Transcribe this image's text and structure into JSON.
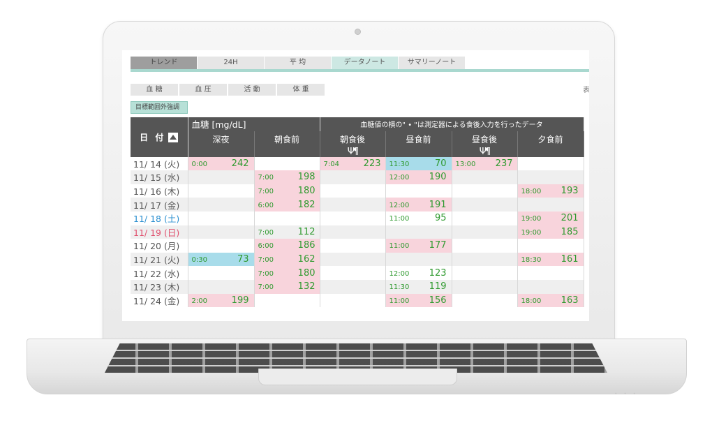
{
  "tabs": [
    "トレンド",
    "24H",
    "平 均",
    "データノート",
    "サマリーノート"
  ],
  "subtabs": [
    "血 糖",
    "血 圧",
    "活 動",
    "体 重"
  ],
  "edge_char": "表",
  "emphasis_button": "目標範囲外強調",
  "table": {
    "date_header": "日 付",
    "unit_title": "血糖 [mg/dL]",
    "note": "血糖値の横の\" • \"は測定器による食後入力を行ったデータ",
    "columns": [
      {
        "label": "深夜",
        "meal_icon": false
      },
      {
        "label": "朝食前",
        "meal_icon": false
      },
      {
        "label": "朝食後",
        "meal_icon": true
      },
      {
        "label": "昼食前",
        "meal_icon": false
      },
      {
        "label": "昼食後",
        "meal_icon": true
      },
      {
        "label": "夕食前",
        "meal_icon": false
      }
    ],
    "meal_icon_glyph": "Ψ¶",
    "rows": [
      {
        "date": "11/ 14 (火)",
        "day": "weekday",
        "cells": [
          [
            "0:00",
            "242",
            "hi"
          ],
          [
            "",
            "",
            ""
          ],
          [
            "7:04",
            "223",
            "hi"
          ],
          [
            "11:30",
            "70",
            "lo"
          ],
          [
            "13:00",
            "237",
            "hi"
          ],
          [
            "",
            "",
            ""
          ]
        ]
      },
      {
        "date": "11/ 15 (水)",
        "day": "weekday",
        "cells": [
          [
            "",
            "",
            ""
          ],
          [
            "7:00",
            "198",
            "hi"
          ],
          [
            "",
            "",
            ""
          ],
          [
            "12:00",
            "190",
            "hi"
          ],
          [
            "",
            "",
            ""
          ],
          [
            "",
            "",
            ""
          ]
        ]
      },
      {
        "date": "11/ 16 (木)",
        "day": "weekday",
        "cells": [
          [
            "",
            "",
            ""
          ],
          [
            "7:00",
            "180",
            "hi"
          ],
          [
            "",
            "",
            ""
          ],
          [
            "",
            "",
            ""
          ],
          [
            "",
            "",
            ""
          ],
          [
            "18:00",
            "193",
            "hi"
          ]
        ]
      },
      {
        "date": "11/ 17 (金)",
        "day": "weekday",
        "cells": [
          [
            "",
            "",
            ""
          ],
          [
            "6:00",
            "182",
            "hi"
          ],
          [
            "",
            "",
            ""
          ],
          [
            "12:00",
            "191",
            "hi"
          ],
          [
            "",
            "",
            ""
          ],
          [
            "",
            "",
            ""
          ]
        ]
      },
      {
        "date": "11/ 18 (土)",
        "day": "sat",
        "cells": [
          [
            "",
            "",
            ""
          ],
          [
            "",
            "",
            ""
          ],
          [
            "",
            "",
            ""
          ],
          [
            "11:00",
            "95",
            ""
          ],
          [
            "",
            "",
            ""
          ],
          [
            "19:00",
            "201",
            "hi"
          ]
        ]
      },
      {
        "date": "11/ 19 (日)",
        "day": "sun",
        "cells": [
          [
            "",
            "",
            ""
          ],
          [
            "7:00",
            "112",
            ""
          ],
          [
            "",
            "",
            ""
          ],
          [
            "",
            "",
            ""
          ],
          [
            "",
            "",
            ""
          ],
          [
            "19:00",
            "185",
            "hi"
          ]
        ]
      },
      {
        "date": "11/ 20 (月)",
        "day": "weekday",
        "cells": [
          [
            "",
            "",
            ""
          ],
          [
            "6:00",
            "186",
            "hi"
          ],
          [
            "",
            "",
            ""
          ],
          [
            "11:00",
            "177",
            "hi"
          ],
          [
            "",
            "",
            ""
          ],
          [
            "",
            "",
            ""
          ]
        ]
      },
      {
        "date": "11/ 21 (火)",
        "day": "weekday",
        "cells": [
          [
            "0:30",
            "73",
            "lo"
          ],
          [
            "7:00",
            "162",
            "hi"
          ],
          [
            "",
            "",
            ""
          ],
          [
            "",
            "",
            ""
          ],
          [
            "",
            "",
            ""
          ],
          [
            "18:30",
            "161",
            "hi"
          ]
        ]
      },
      {
        "date": "11/ 22 (水)",
        "day": "weekday",
        "cells": [
          [
            "",
            "",
            ""
          ],
          [
            "7:00",
            "180",
            "hi"
          ],
          [
            "",
            "",
            ""
          ],
          [
            "12:00",
            "123",
            ""
          ],
          [
            "",
            "",
            ""
          ],
          [
            "",
            "",
            ""
          ]
        ]
      },
      {
        "date": "11/ 23 (木)",
        "day": "weekday",
        "cells": [
          [
            "",
            "",
            ""
          ],
          [
            "7:00",
            "132",
            "hi"
          ],
          [
            "",
            "",
            ""
          ],
          [
            "11:30",
            "119",
            ""
          ],
          [
            "",
            "",
            ""
          ],
          [
            "",
            "",
            ""
          ]
        ]
      },
      {
        "date": "11/ 24 (金)",
        "day": "weekday",
        "cells": [
          [
            "2:00",
            "199",
            "hi"
          ],
          [
            "",
            "",
            ""
          ],
          [
            "",
            "",
            ""
          ],
          [
            "11:00",
            "156",
            "hi"
          ],
          [
            "",
            "",
            ""
          ],
          [
            "18:00",
            "163",
            "hi"
          ]
        ]
      }
    ]
  }
}
